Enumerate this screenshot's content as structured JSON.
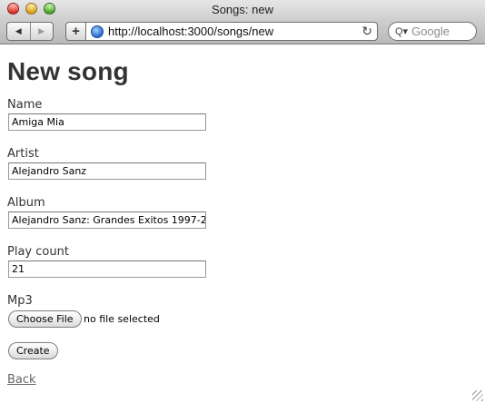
{
  "window": {
    "title": "Songs: new"
  },
  "toolbar": {
    "back_glyph": "◀",
    "forward_glyph": "▶",
    "add_glyph": "+",
    "url": "http://localhost:3000/songs/new",
    "reload_glyph": "↻",
    "search_placeholder": "Google",
    "search_glyph": "Q▾"
  },
  "page": {
    "heading": "New song",
    "fields": {
      "name": {
        "label": "Name",
        "value": "Amiga Mia"
      },
      "artist": {
        "label": "Artist",
        "value": "Alejandro Sanz"
      },
      "album": {
        "label": "Album",
        "value": "Alejandro Sanz: Grandes Exitos 1997-2"
      },
      "play_count": {
        "label": "Play count",
        "value": "21"
      },
      "mp3": {
        "label": "Mp3",
        "button": "Choose File",
        "status": "no file selected"
      }
    },
    "submit_label": "Create",
    "back_label": "Back"
  }
}
